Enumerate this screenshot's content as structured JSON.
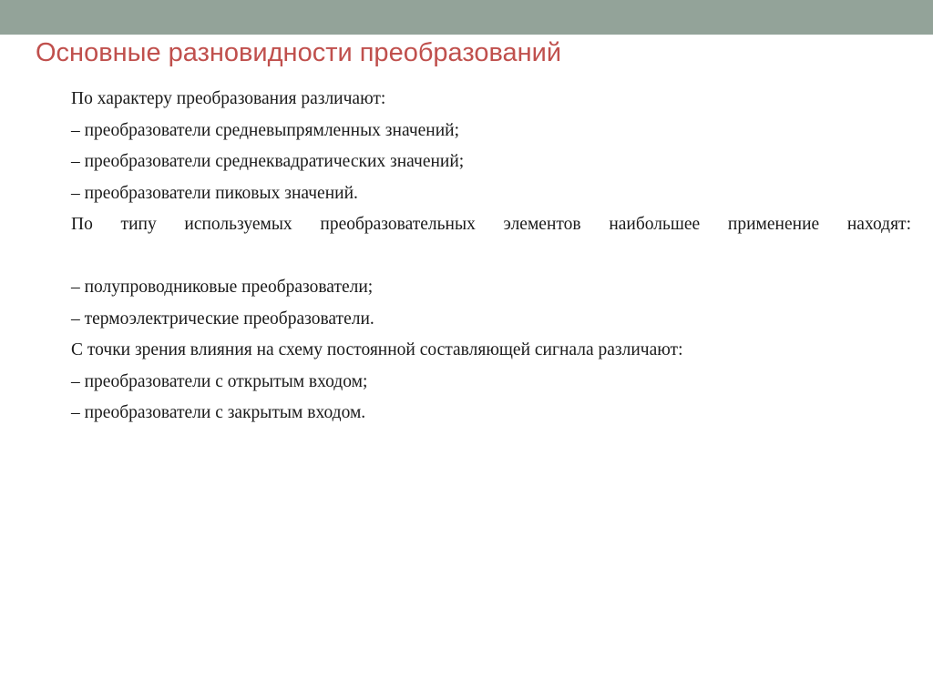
{
  "theme": {
    "band_color": "#93a399",
    "title_color": "#c0504d",
    "body_color": "#1a1a1a",
    "background_color": "#ffffff"
  },
  "slide": {
    "title": "Основные разновидности преобразований",
    "paragraphs": [
      {
        "id": "p1",
        "style": "single",
        "text": "По характеру преобразования различают:"
      },
      {
        "id": "p2",
        "style": "dash",
        "text": "– преобразователи средневыпрямленных значений;"
      },
      {
        "id": "p3",
        "style": "dash",
        "text": "– преобразователи среднеквадратических значений;"
      },
      {
        "id": "p4",
        "style": "dash",
        "text": "– преобразователи пиковых значений."
      },
      {
        "id": "p5",
        "style": "flow",
        "text": "По типу используемых преобразовательных элементов наибольшее применение находят:"
      },
      {
        "id": "p6",
        "style": "dash",
        "text": "– полупроводниковые преобразователи;"
      },
      {
        "id": "p7",
        "style": "dash",
        "text": "– термоэлектрические преобразователи."
      },
      {
        "id": "p8",
        "style": "single",
        "text": "С точки зрения влияния на схему постоянной составляющей сигнала различают:"
      },
      {
        "id": "p9",
        "style": "dash",
        "text": "– преобразователи с открытым входом;"
      },
      {
        "id": "p10",
        "style": "dash",
        "text": "– преобразователи с закрытым входом."
      }
    ]
  }
}
